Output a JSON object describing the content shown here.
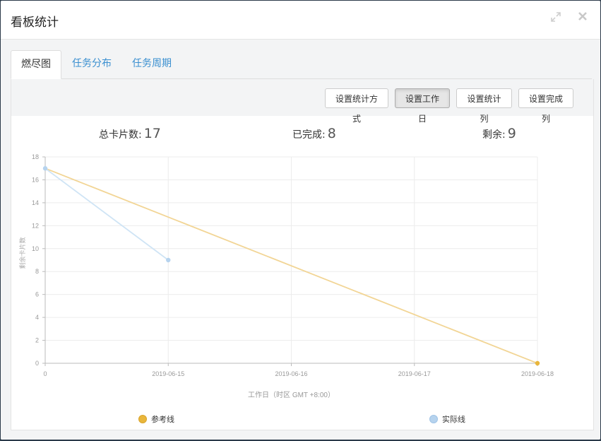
{
  "dialog": {
    "title": "看板统计",
    "expand_icon": "expand-icon",
    "close_icon": "close-icon"
  },
  "tabs": [
    {
      "label": "燃尽图",
      "active": true
    },
    {
      "label": "任务分布",
      "active": false
    },
    {
      "label": "任务周期",
      "active": false
    }
  ],
  "toolbar": {
    "buttons": [
      "设置统计方式",
      "设置工作日",
      "设置统计列",
      "设置完成列"
    ],
    "pressed_index": 1
  },
  "stats": {
    "total_label": "总卡片数:",
    "total_value": "17",
    "done_label": "已完成:",
    "done_value": "8",
    "remain_label": "剩余:",
    "remain_value": "9"
  },
  "chart_data": {
    "type": "line",
    "xlabel": "工作日（时区 GMT +8:00）",
    "ylabel": "剩余卡片数",
    "ylim": [
      0,
      18
    ],
    "yticks": [
      0,
      2,
      4,
      6,
      8,
      10,
      12,
      14,
      16,
      18
    ],
    "x_categories": [
      "0",
      "2019-06-15",
      "2019-06-16",
      "2019-06-17",
      "2019-06-18"
    ],
    "series": [
      {
        "name": "参考线",
        "color": "#f2d595",
        "marker_color": "#e9b63b",
        "x_index": [
          0,
          4
        ],
        "values": [
          17,
          0
        ]
      },
      {
        "name": "实际线",
        "color": "#cfe4f5",
        "marker_color": "#b6d3ee",
        "x_index": [
          0,
          1
        ],
        "values": [
          17,
          9
        ]
      }
    ],
    "grid": true
  }
}
